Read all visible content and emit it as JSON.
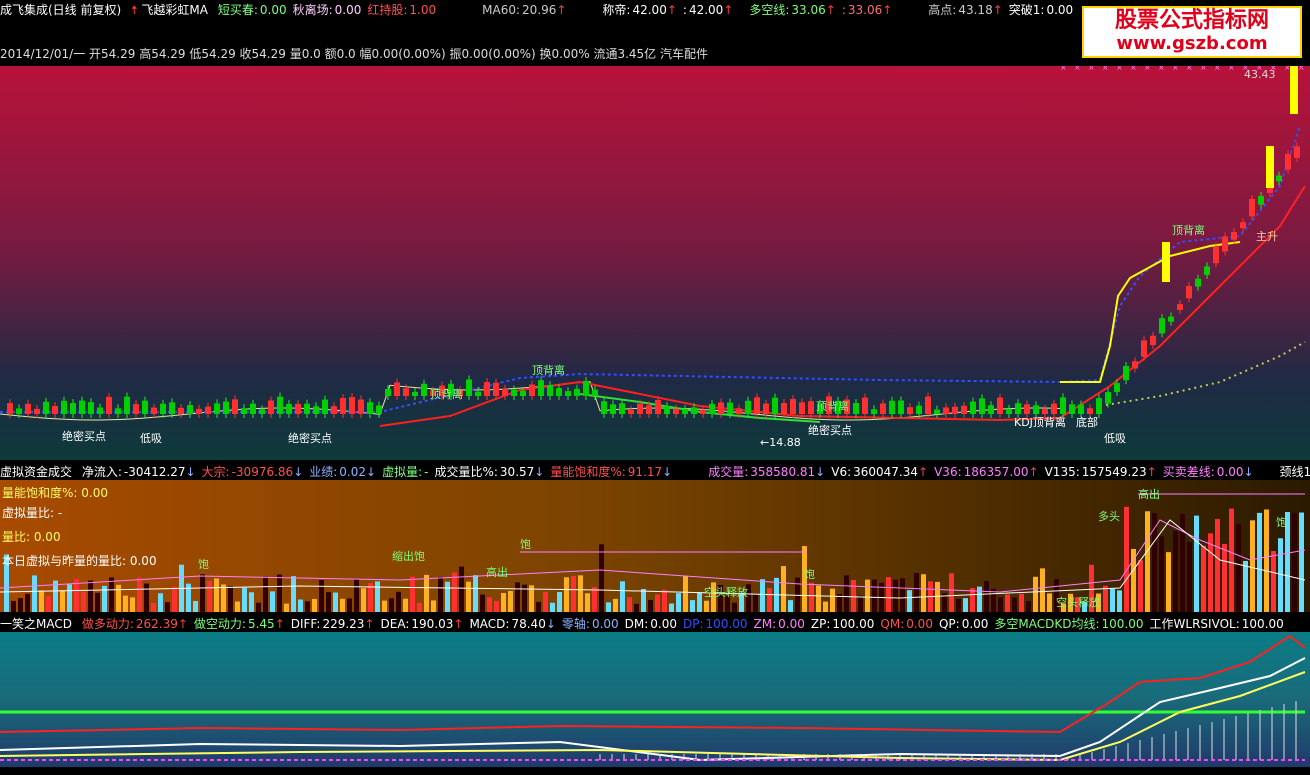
{
  "header": {
    "title": "成飞集成(日线 前复权)",
    "indicator": "飞越彩虹MA",
    "items": [
      {
        "label": "短买春:",
        "value": "0.00",
        "color": "#7dff7d"
      },
      {
        "label": "秋离场:",
        "value": "0.00",
        "color": "#ffd0ff"
      },
      {
        "label": "红持股:",
        "value": "1.00",
        "color": "#ff5050"
      },
      {
        "label": "MA60:",
        "value": "20.96",
        "arrow": "↑",
        "color": "#cccccc"
      },
      {
        "label": "称帝:",
        "value": "42.00",
        "arrow": "↑",
        "color": "#ffffff"
      },
      {
        "label": ":",
        "value": "42.00",
        "arrow": "↑",
        "color": "#ffffff"
      },
      {
        "label": "多空线:",
        "value": "33.06",
        "arrow": "↑",
        "color": "#7dff7d"
      },
      {
        "label": ":",
        "value": "33.06",
        "arrow": "↑",
        "color": "#ff7070"
      },
      {
        "label": "高点:",
        "value": "43.18",
        "arrow": "↑",
        "color": "#cccccc"
      },
      {
        "label": "突破1:",
        "value": "0.00",
        "color": "#ffffff"
      }
    ]
  },
  "logo": {
    "line1": "股票公式指标网",
    "line2": "www.gszb.com"
  },
  "info_line": "2014/12/01/一 开54.29 高54.29 低54.29 收54.29 量0.0 额0.0 幅0.00(0.00%) 振0.00(0.00%) 换0.00% 流通3.45亿 汽车配件",
  "price_labels": {
    "high": "43.43",
    "low": "←14.88",
    "tags": [
      "顶背离",
      "顶背离",
      "顶背离",
      "顶背离",
      "绝密买点",
      "绝密买点",
      "绝密买点",
      "低吸",
      "低吸",
      "KDJ顶背离",
      "底部",
      "主升"
    ]
  },
  "volume_header": {
    "name": "虚拟资金成交",
    "items": [
      {
        "label": "净流入:",
        "value": "-30412.27",
        "arrow": "↓",
        "color": "#ffffff"
      },
      {
        "label": "大宗:",
        "value": "-30976.86",
        "arrow": "↓",
        "color": "#ff5050"
      },
      {
        "label": "业绩:",
        "value": "0.02",
        "arrow": "↓",
        "color": "#8fb3ff"
      },
      {
        "label": "虚拟量:",
        "value": "-",
        "color": "#7dff7d"
      },
      {
        "label": "成交量比%:",
        "value": "30.57",
        "arrow": "↓",
        "color": "#ffffff"
      },
      {
        "label": "量能饱和度%:",
        "value": "91.17",
        "arrow": "↓",
        "color": "#ff5050"
      },
      {
        "label": "成交量:",
        "value": "358580.81",
        "arrow": "↓",
        "color": "#ff80ff"
      },
      {
        "label": "V6:",
        "value": "360047.34",
        "arrow": "↑",
        "color": "#ffffff"
      },
      {
        "label": "V36:",
        "value": "186357.00",
        "arrow": "↑",
        "color": "#ff80ff"
      },
      {
        "label": "V135:",
        "value": "157549.23",
        "arrow": "↑",
        "color": "#ffffff"
      },
      {
        "label": "买卖差线:",
        "value": "0.00",
        "arrow": "↓",
        "color": "#ff80ff"
      },
      {
        "label": "颈线1:",
        "value": "-",
        "color": "#ffffff"
      }
    ],
    "sub": [
      {
        "label": "量能饱和度%:",
        "value": "0.00",
        "color": "#ffff66"
      },
      {
        "label": "虚拟量比:",
        "value": "-",
        "color": "#ffffff"
      },
      {
        "label": "量比:",
        "value": "0.00",
        "color": "#ffff66"
      },
      {
        "label": "本日虚拟与昨量的量比:",
        "value": "0.00",
        "color": "#ffffff"
      }
    ],
    "tags": [
      "饱",
      "缩出饱",
      "高出",
      "饱",
      "饱",
      "饱",
      "高出",
      "多头",
      "空头释放",
      "空头释放"
    ]
  },
  "macd_header": {
    "name": "一笑之MACD",
    "items": [
      {
        "label": "做多动力:",
        "value": "262.39",
        "arrow": "↑",
        "color": "#ff5050"
      },
      {
        "label": "做空动力:",
        "value": "5.45",
        "arrow": "↑",
        "color": "#7dff7d"
      },
      {
        "label": "DIFF:",
        "value": "229.23",
        "arrow": "↑",
        "color": "#ffffff"
      },
      {
        "label": "DEA:",
        "value": "190.03",
        "arrow": "↑",
        "color": "#ffffff"
      },
      {
        "label": "MACD:",
        "value": "78.40",
        "arrow": "↓",
        "color": "#ffffff"
      },
      {
        "label": "零轴:",
        "value": "0.00",
        "color": "#8fb3ff"
      },
      {
        "label": "DM:",
        "value": "0.00",
        "color": "#ffffff"
      },
      {
        "label": "DP:",
        "value": "100.00",
        "color": "#3050ff"
      },
      {
        "label": "ZM:",
        "value": "0.00",
        "color": "#ff80ff"
      },
      {
        "label": "ZP:",
        "value": "100.00",
        "color": "#ffffff"
      },
      {
        "label": "QM:",
        "value": "0.00",
        "color": "#ff5050"
      },
      {
        "label": "QP:",
        "value": "0.00",
        "color": "#ffffff"
      },
      {
        "label": "多空MACDKD均线:",
        "value": "100.00",
        "color": "#7dff7d"
      },
      {
        "label": "工作WLRSIVOL:",
        "value": "100.00",
        "color": "#ffffff"
      }
    ]
  }
}
